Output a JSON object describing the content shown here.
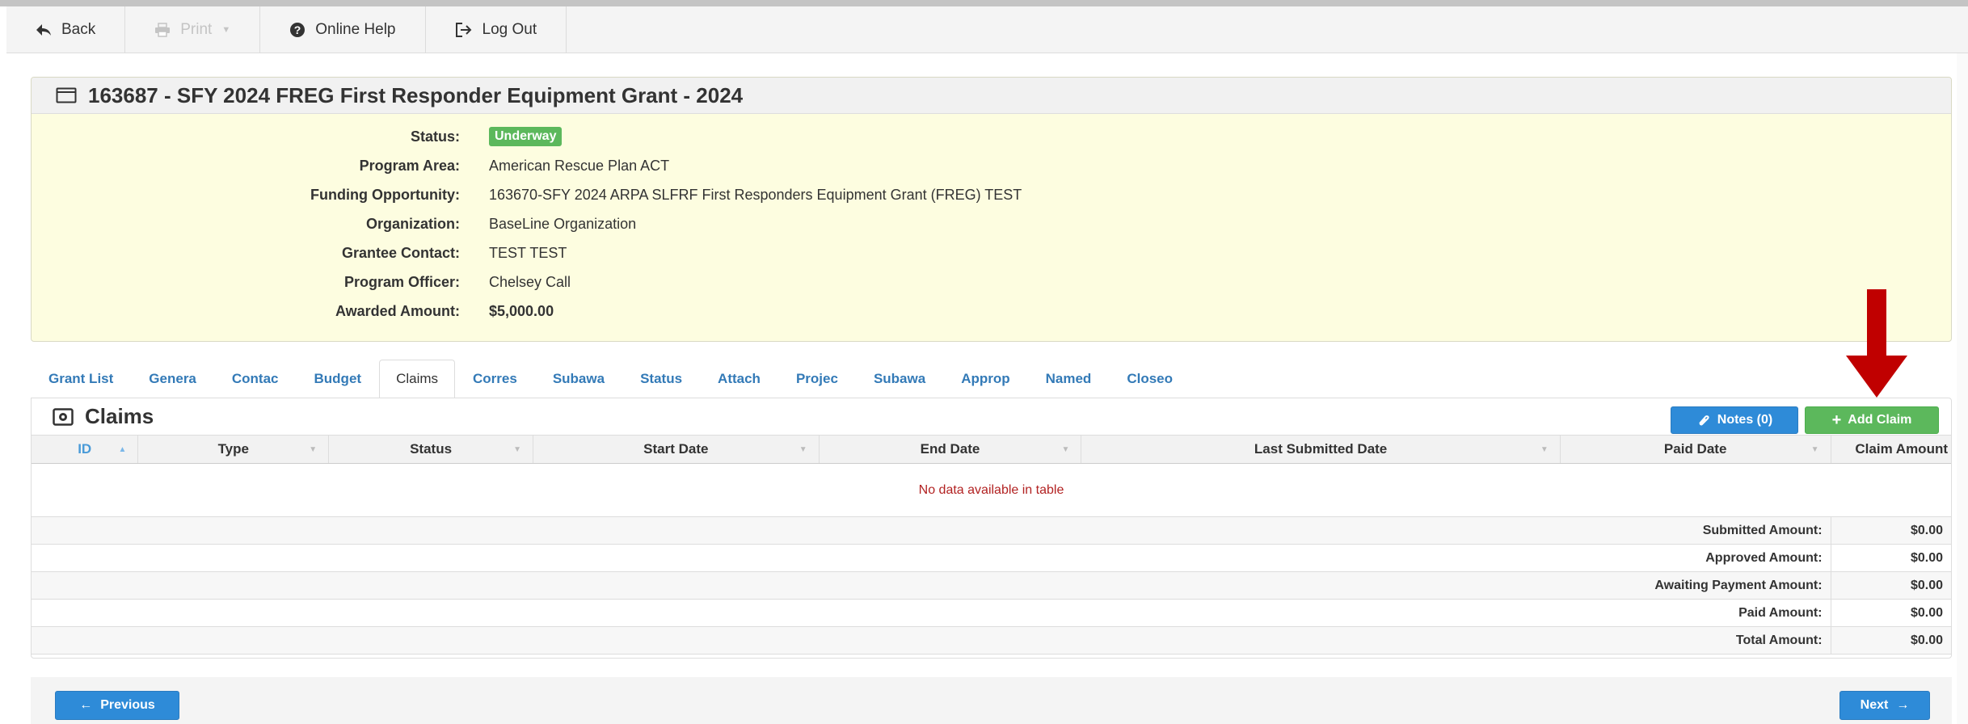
{
  "toolbar": {
    "back_label": "Back",
    "print_label": "Print",
    "help_label": "Online Help",
    "logout_label": "Log Out"
  },
  "grant": {
    "title": "163687 - SFY 2024 FREG First Responder Equipment Grant - 2024",
    "fields": {
      "status_label": "Status:",
      "status_value": "Underway",
      "program_area_label": "Program Area:",
      "program_area_value": "American Rescue Plan ACT",
      "funding_label": "Funding Opportunity:",
      "funding_value": "163670-SFY 2024 ARPA SLFRF First Responders Equipment Grant (FREG) TEST",
      "organization_label": "Organization:",
      "organization_value": "BaseLine Organization",
      "contact_label": "Grantee Contact:",
      "contact_value": "TEST TEST",
      "officer_label": "Program Officer:",
      "officer_value": "Chelsey Call",
      "awarded_label": "Awarded Amount:",
      "awarded_value": "$5,000.00"
    }
  },
  "tabs": [
    "Grant List",
    "Genera",
    "Contac",
    "Budget",
    "Claims",
    "Corres",
    "Subawa",
    "Status",
    "Attach",
    "Projec",
    "Subawa",
    "Approp",
    "Named",
    "Closeo"
  ],
  "claims": {
    "title": "Claims",
    "notes_label": "Notes (0)",
    "add_label": "Add Claim",
    "columns": [
      "ID",
      "Type",
      "Status",
      "Start Date",
      "End Date",
      "Last Submitted Date",
      "Paid Date",
      "Claim Amount"
    ],
    "empty_message": "No data available in table",
    "summary": [
      {
        "label": "Submitted Amount:",
        "value": "$0.00"
      },
      {
        "label": "Approved Amount:",
        "value": "$0.00"
      },
      {
        "label": "Awaiting Payment Amount:",
        "value": "$0.00"
      },
      {
        "label": "Paid Amount:",
        "value": "$0.00"
      },
      {
        "label": "Total Amount:",
        "value": "$0.00"
      }
    ]
  },
  "footer": {
    "previous_label": "Previous",
    "next_label": "Next"
  },
  "colors": {
    "accent_blue": "#2e8bd8",
    "success_green": "#5cb85c",
    "panel_yellow": "#fdfde0",
    "annotation_red": "#c00000"
  }
}
